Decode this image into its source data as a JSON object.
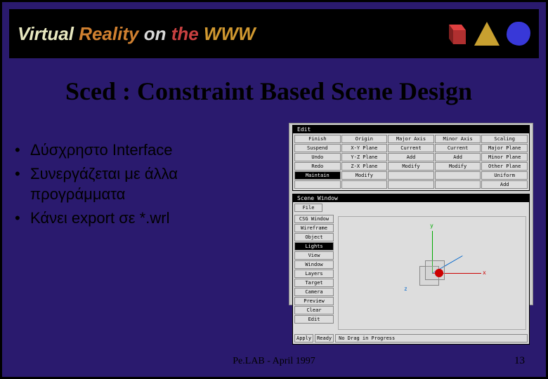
{
  "banner": {
    "words": [
      "Virtual",
      "Reality",
      "on",
      "the",
      "WWW"
    ],
    "shapes": [
      "cube",
      "cone",
      "blob"
    ]
  },
  "title": "Sced : Constraint Based Scene Design",
  "bullets": [
    "Δύσχρηστο Interface",
    "Συνεργάζεται με άλλα προγράμματα",
    "Κάνει export σε *.wrl"
  ],
  "app": {
    "editWindow": {
      "title": "Edit",
      "rows": [
        [
          "Finish",
          "Origin",
          "Major Axis",
          "Minor Axis",
          "Scaling"
        ],
        [
          "Suspend",
          "X-Y Plane",
          "Current",
          "Current",
          "Major Plane"
        ],
        [
          "Undo",
          "Y-Z Plane",
          "Add",
          "Add",
          "Minor Plane"
        ],
        [
          "Redo",
          "Z-X Plane",
          "Modify",
          "Modify",
          "Other Plane"
        ],
        [
          "Maintain",
          "Modify",
          "",
          "",
          "Uniform"
        ],
        [
          "",
          "",
          "",
          "",
          "Add"
        ]
      ],
      "highlighted": "Maintain"
    },
    "sceneWindow": {
      "title": "Scene Window",
      "menu": "File",
      "sideButtons": [
        "CSG Window",
        "Wireframe",
        "Object",
        "Lights",
        "View",
        "Window",
        "Layers",
        "Target",
        "Camera",
        "Preview",
        "Clear",
        "Edit"
      ],
      "highlighted": "Lights",
      "axes": {
        "x": "x",
        "y": "y",
        "z": "z"
      },
      "statusBar": {
        "apply": "Apply",
        "ready": "Ready",
        "msg": "No Drag in Progress"
      }
    }
  },
  "footer": "Pe.LAB - April 1997",
  "pageNumber": "13"
}
